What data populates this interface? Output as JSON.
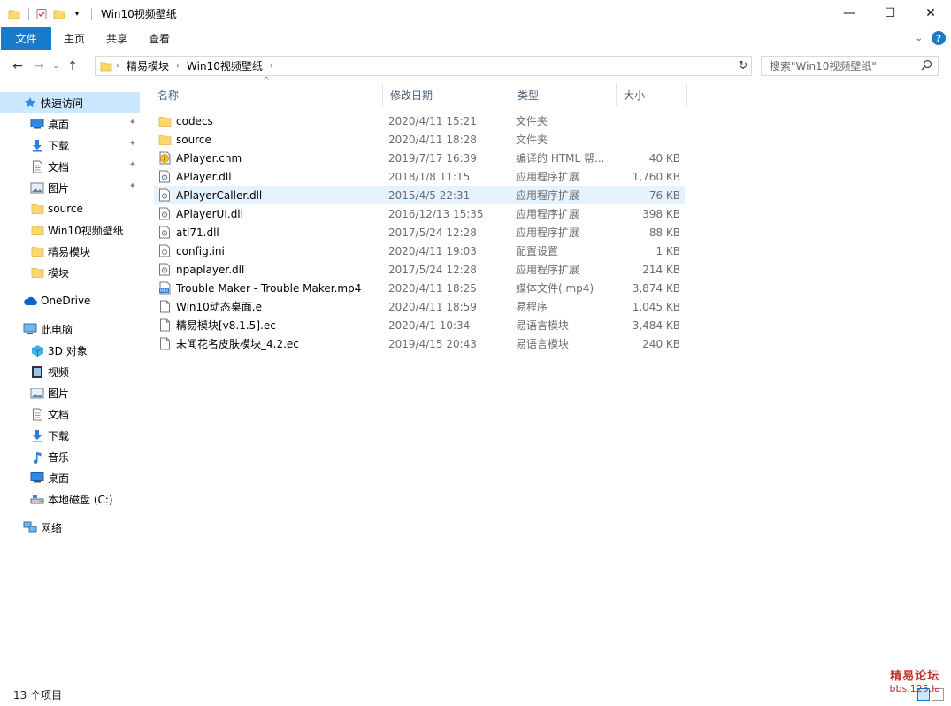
{
  "window": {
    "title": "Win10视频壁纸",
    "minimize": "—",
    "maximize": "☐",
    "close": "✕"
  },
  "ribbon": {
    "tabs": [
      "文件",
      "主页",
      "共享",
      "查看"
    ]
  },
  "address": {
    "crumbs": [
      "精易模块",
      "Win10视频壁纸"
    ]
  },
  "search": {
    "placeholder": "搜索\"Win10视频壁纸\""
  },
  "sidebar": {
    "quick_access": "快速访问",
    "quick_items": [
      {
        "label": "桌面",
        "icon": "desktop-icon",
        "pinned": true
      },
      {
        "label": "下载",
        "icon": "download-icon",
        "pinned": true
      },
      {
        "label": "文档",
        "icon": "document-icon",
        "pinned": true
      },
      {
        "label": "图片",
        "icon": "picture-icon",
        "pinned": true
      },
      {
        "label": "source",
        "icon": "folder-icon",
        "pinned": false
      },
      {
        "label": "Win10视频壁纸",
        "icon": "folder-icon",
        "pinned": false
      },
      {
        "label": "精易模块",
        "icon": "folder-icon",
        "pinned": false
      },
      {
        "label": "模块",
        "icon": "folder-icon",
        "pinned": false
      }
    ],
    "onedrive": "OneDrive",
    "this_pc": "此电脑",
    "pc_items": [
      {
        "label": "3D 对象",
        "icon": "3d-objects-icon"
      },
      {
        "label": "视频",
        "icon": "video-icon"
      },
      {
        "label": "图片",
        "icon": "picture-icon"
      },
      {
        "label": "文档",
        "icon": "document-icon"
      },
      {
        "label": "下载",
        "icon": "download-icon"
      },
      {
        "label": "音乐",
        "icon": "music-icon"
      },
      {
        "label": "桌面",
        "icon": "desktop-icon"
      },
      {
        "label": "本地磁盘 (C:)",
        "icon": "drive-icon"
      }
    ],
    "network": "网络"
  },
  "columns": {
    "name": "名称",
    "date": "修改日期",
    "type": "类型",
    "size": "大小"
  },
  "files": [
    {
      "name": "codecs",
      "date": "2020/4/11 15:21",
      "type": "文件夹",
      "size": "",
      "icon": "folder-icon"
    },
    {
      "name": "source",
      "date": "2020/4/11 18:28",
      "type": "文件夹",
      "size": "",
      "icon": "folder-icon"
    },
    {
      "name": "APlayer.chm",
      "date": "2019/7/17 16:39",
      "type": "编译的 HTML 帮...",
      "size": "40 KB",
      "icon": "help-file-icon"
    },
    {
      "name": "APlayer.dll",
      "date": "2018/1/8 11:15",
      "type": "应用程序扩展",
      "size": "1,760 KB",
      "icon": "dll-icon"
    },
    {
      "name": "APlayerCaller.dll",
      "date": "2015/4/5 22:31",
      "type": "应用程序扩展",
      "size": "76 KB",
      "icon": "dll-icon"
    },
    {
      "name": "APlayerUI.dll",
      "date": "2016/12/13 15:35",
      "type": "应用程序扩展",
      "size": "398 KB",
      "icon": "dll-icon"
    },
    {
      "name": "atl71.dll",
      "date": "2017/5/24 12:28",
      "type": "应用程序扩展",
      "size": "88 KB",
      "icon": "dll-icon"
    },
    {
      "name": "config.ini",
      "date": "2020/4/11 19:03",
      "type": "配置设置",
      "size": "1 KB",
      "icon": "config-file-icon"
    },
    {
      "name": "npaplayer.dll",
      "date": "2017/5/24 12:28",
      "type": "应用程序扩展",
      "size": "214 KB",
      "icon": "dll-icon"
    },
    {
      "name": "Trouble Maker - Trouble Maker.mp4",
      "date": "2020/4/11 18:25",
      "type": "媒体文件(.mp4)",
      "size": "3,874 KB",
      "icon": "video-file-icon"
    },
    {
      "name": "Win10动态桌面.e",
      "date": "2020/4/11 18:59",
      "type": "易程序",
      "size": "1,045 KB",
      "icon": "file-icon"
    },
    {
      "name": "精易模块[v8.1.5].ec",
      "date": "2020/4/1 10:34",
      "type": "易语言模块",
      "size": "3,484 KB",
      "icon": "file-icon"
    },
    {
      "name": "未闻花名皮肤模块_4.2.ec",
      "date": "2019/4/15 20:43",
      "type": "易语言模块",
      "size": "240 KB",
      "icon": "file-icon"
    }
  ],
  "status": {
    "item_count": "13 个项目"
  },
  "watermark": {
    "line1": "精易论坛",
    "line2": "bbs.125.la"
  },
  "colors": {
    "accent": "#1979ca",
    "selection": "#cce8ff",
    "hover": "#e5f3ff",
    "folder": "#ffd86c"
  }
}
